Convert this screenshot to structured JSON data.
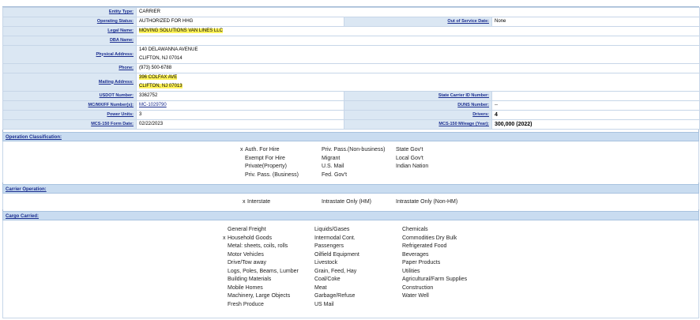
{
  "snapshot": {
    "rows": [
      {
        "label": "Entity Type:",
        "value": "CARRIER"
      },
      {
        "label": "Operating Status:",
        "value": "AUTHORIZED FOR HHG",
        "label2": "Out of Service Date:",
        "value2": "None"
      },
      {
        "label": "Legal Name:",
        "value": "MOVING SOLUTIONS VAN LINES LLC"
      },
      {
        "label": "DBA Name:",
        "value": ""
      },
      {
        "label": "Physical Address:",
        "value": "140 DELAWANNA AVENUE",
        "value_line2": "CLIFTON, NJ   07014"
      },
      {
        "label": "Phone:",
        "value": "(973) 500-6788"
      },
      {
        "label": "Mailing Address:",
        "value": "396 COLFAX AVE",
        "value_line2": "CLIFTON, NJ   07013"
      },
      {
        "label": "USDOT Number:",
        "value": "3362752",
        "label2": "State Carrier ID Number:",
        "value2": ""
      },
      {
        "label": "MC/MX/FF Number(s):",
        "value": "MC-1029790",
        "label2": "DUNS Number:",
        "value2": "--"
      },
      {
        "label": "Power Units:",
        "value": "3",
        "label2": "Drivers:",
        "value2": "4"
      },
      {
        "label": "MCS-150 Form Date:",
        "value": "02/22/2023",
        "label2": "MCS-150 Mileage (Year):",
        "value2": "300,000 (2022)"
      }
    ]
  },
  "operation_classification": {
    "title": "Operation Classification:",
    "columns": [
      [
        {
          "text": "Auth. For Hire",
          "checked": "x"
        },
        {
          "text": "Exempt For Hire",
          "checked": ""
        },
        {
          "text": "Private(Property)",
          "checked": ""
        },
        {
          "text": "Priv. Pass. (Business)",
          "checked": ""
        }
      ],
      [
        {
          "text": "Priv. Pass.(Non-business)",
          "checked": ""
        },
        {
          "text": "Migrant",
          "checked": ""
        },
        {
          "text": "U.S. Mail",
          "checked": ""
        },
        {
          "text": "Fed. Gov't",
          "checked": ""
        }
      ],
      [
        {
          "text": "State Gov't",
          "checked": ""
        },
        {
          "text": "Local Gov't",
          "checked": ""
        },
        {
          "text": "Indian Nation",
          "checked": ""
        }
      ]
    ]
  },
  "carrier_operation": {
    "title": "Carrier Operation:",
    "items": [
      {
        "text": "Interstate",
        "checked": "x"
      },
      {
        "text": "Intrastate Only (HM)",
        "checked": ""
      },
      {
        "text": "Intrastate Only (Non-HM)",
        "checked": ""
      }
    ]
  },
  "cargo_carried": {
    "title": "Cargo Carried:",
    "columns": [
      [
        {
          "text": "General Freight",
          "checked": ""
        },
        {
          "text": "Household Goods",
          "checked": "x"
        },
        {
          "text": "Metal: sheets, coils, rolls",
          "checked": ""
        },
        {
          "text": "Motor Vehicles",
          "checked": ""
        },
        {
          "text": "Drive/Tow away",
          "checked": ""
        },
        {
          "text": "Logs, Poles, Beams, Lumber",
          "checked": ""
        },
        {
          "text": "Building Materials",
          "checked": ""
        },
        {
          "text": "Mobile Homes",
          "checked": ""
        },
        {
          "text": "Machinery, Large Objects",
          "checked": ""
        },
        {
          "text": "Fresh Produce",
          "checked": ""
        }
      ],
      [
        {
          "text": "Liquids/Gases",
          "checked": ""
        },
        {
          "text": "Intermodal Cont.",
          "checked": ""
        },
        {
          "text": "Passengers",
          "checked": ""
        },
        {
          "text": "Oilfield Equipment",
          "checked": ""
        },
        {
          "text": "Livestock",
          "checked": ""
        },
        {
          "text": "Grain, Feed, Hay",
          "checked": ""
        },
        {
          "text": "Coal/Coke",
          "checked": ""
        },
        {
          "text": "Meat",
          "checked": ""
        },
        {
          "text": "Garbage/Refuse",
          "checked": ""
        },
        {
          "text": "US Mail",
          "checked": ""
        }
      ],
      [
        {
          "text": "Chemicals",
          "checked": ""
        },
        {
          "text": "Commodities Dry Bulk",
          "checked": ""
        },
        {
          "text": "Refrigerated Food",
          "checked": ""
        },
        {
          "text": "Beverages",
          "checked": ""
        },
        {
          "text": "Paper Products",
          "checked": ""
        },
        {
          "text": "Utilities",
          "checked": ""
        },
        {
          "text": "Agricultural/Farm Supplies",
          "checked": ""
        },
        {
          "text": "Construction",
          "checked": ""
        },
        {
          "text": "Water Well",
          "checked": ""
        }
      ]
    ]
  },
  "colors": {
    "label_bg": "#dbe7f3",
    "section_bg": "#c9dcf0",
    "link": "#1a2d8f",
    "highlight": "#fff35a"
  }
}
